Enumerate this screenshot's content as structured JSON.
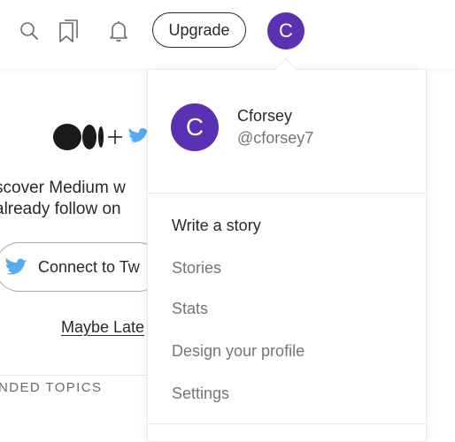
{
  "colors": {
    "avatar_bg": "#5a31b3",
    "twitter_blue": "#55acee",
    "text_dark": "#292929",
    "text_muted": "#757575"
  },
  "header": {
    "icons": [
      "search-icon",
      "bookmarks-icon",
      "notifications-bell-icon"
    ],
    "upgrade_label": "Upgrade",
    "avatar_initial": "C"
  },
  "background_page": {
    "line1": "scover Medium w",
    "line2": "already follow on",
    "connect_label": "Connect to Tw",
    "maybe_later": "Maybe Late",
    "topics_label": "NDED TOPICS"
  },
  "dropdown": {
    "profile": {
      "initial": "C",
      "name": "Cforsey",
      "handle": "@cforsey7"
    },
    "menu": [
      {
        "label": "Write a story"
      },
      {
        "label": "Stories"
      },
      {
        "label": "Stats"
      },
      {
        "label": "Design your profile"
      },
      {
        "label": "Settings"
      }
    ]
  }
}
